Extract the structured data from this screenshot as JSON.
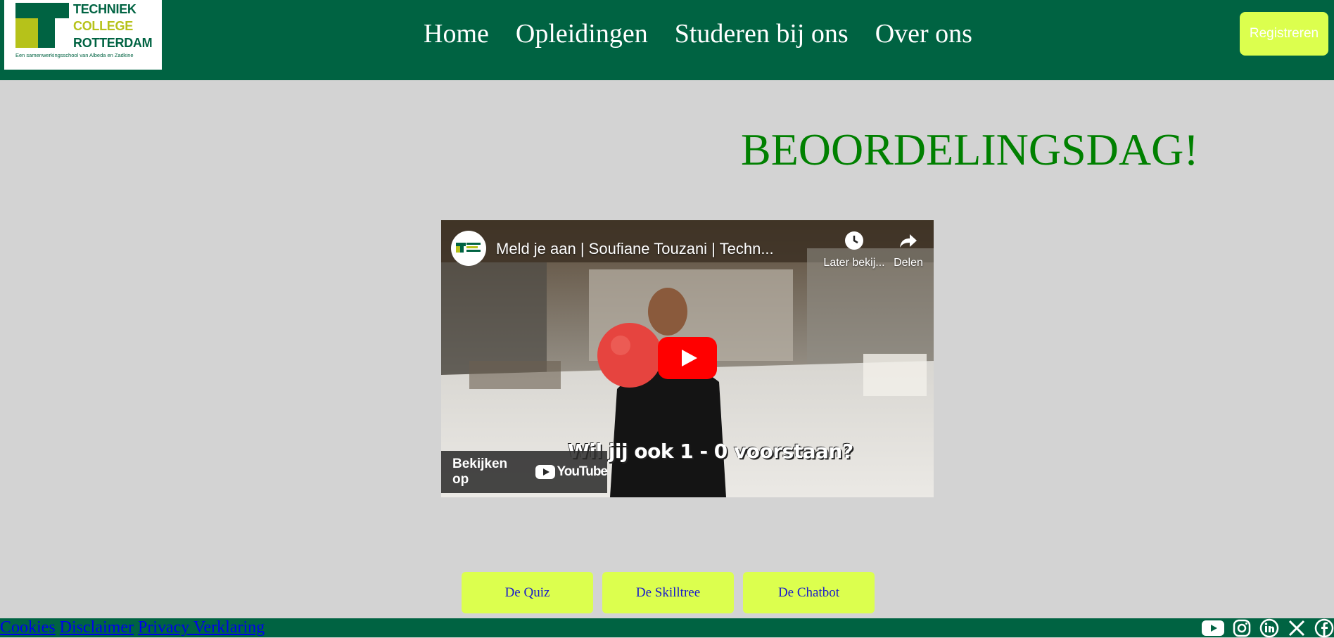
{
  "header": {
    "logo": {
      "line1": "TECHNIEK",
      "line2": "COLLEGE",
      "line3": "ROTTERDAM",
      "tagline": "Een samenwerkingsschool van Albeda en Zadkine",
      "colors": {
        "green": "#006342",
        "lime": "#b6c21a"
      }
    },
    "nav": [
      "Home",
      "Opleidingen",
      "Studeren bij ons",
      "Over ons"
    ],
    "register_label": "Registreren"
  },
  "main": {
    "title": "BEOORDELINGSDAG!",
    "video": {
      "title": "Meld je aan | Soufiane Touzani | Techn...",
      "watch_later": "Later bekij...",
      "share": "Delen",
      "caption": "Wil jij ook 1 - 0 voorstaan?",
      "watch_on": "Bekijken op",
      "platform": "YouTube"
    },
    "buttons": [
      "De Quiz",
      "De Skilltree",
      "De Chatbot"
    ]
  },
  "footer": {
    "links": [
      "Cookies",
      "Disclaimer",
      "Privacy Verklaring"
    ],
    "social_icons": [
      "youtube-icon",
      "instagram-icon",
      "linkedin-icon",
      "x-icon",
      "facebook-icon"
    ]
  },
  "colors": {
    "header_bg": "#006342",
    "page_bg": "#d3d3d3",
    "accent": "#dcff4e",
    "title": "#008000",
    "button_text": "#1a1acd"
  }
}
